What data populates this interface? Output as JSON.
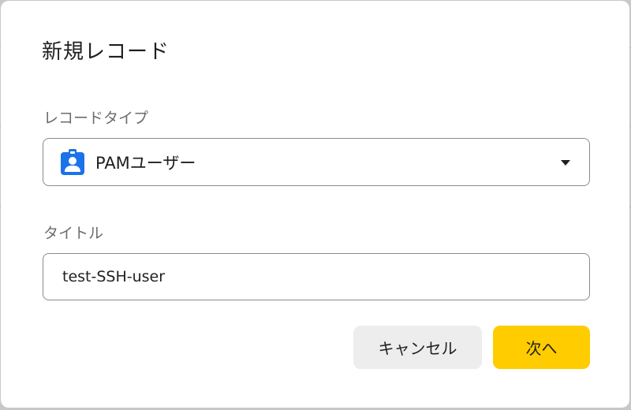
{
  "dialog": {
    "title": "新規レコード",
    "record_type": {
      "label": "レコードタイプ",
      "selected_value": "PAMユーザー",
      "icon": "user-badge-icon",
      "icon_color": "#1a73e8"
    },
    "title_field": {
      "label": "タイトル",
      "value": "test-SSH-user"
    },
    "buttons": {
      "cancel_label": "キャンセル",
      "next_label": "次へ",
      "next_color": "#ffcc00"
    }
  }
}
